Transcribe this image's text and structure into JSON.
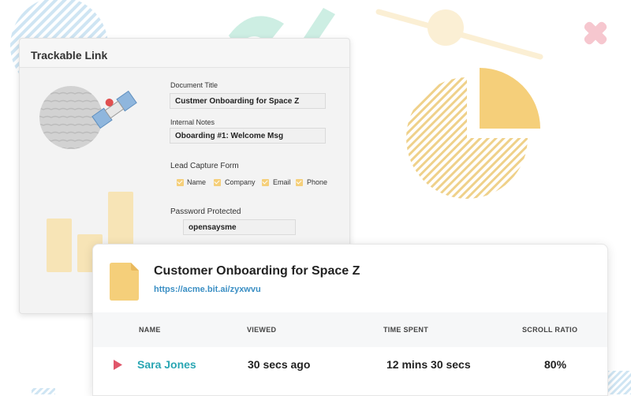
{
  "colors": {
    "accent_yellow": "#f5cf7a",
    "light_yellow": "#f7e4b6",
    "link_blue": "#3b8fc4",
    "name_teal": "#2aa6b3",
    "play_red": "#e0566a",
    "decor_mint": "#cdeee3",
    "decor_blue": "#cfe5f3",
    "decor_pink": "#f6c7cf"
  },
  "trackable_card": {
    "title": "Trackable Link",
    "document_title_label": "Document Title",
    "document_title_value": "Custmer Onboarding for Space Z",
    "internal_notes_label": "Internal Notes",
    "internal_notes_value": "Oboarding  #1: Welcome Msg",
    "lead_capture_label": "Lead Capture Form",
    "lead_fields": [
      {
        "label": "Name",
        "checked": true
      },
      {
        "label": "Company",
        "checked": true
      },
      {
        "label": "Email",
        "checked": true
      },
      {
        "label": "Phone",
        "checked": true
      }
    ],
    "password_label": "Password Protected",
    "password_value": "opensaysme"
  },
  "analytics_card": {
    "icon": "document-icon",
    "title": "Customer Onboarding for Space Z",
    "link": "https://acme.bit.ai/zyxwvu",
    "columns": [
      "NAME",
      "VIEWED",
      "TIME SPENT",
      "SCROLL RATIO"
    ],
    "rows": [
      {
        "name": "Sara Jones",
        "viewed": "30 secs ago",
        "time_spent": "12 mins 30 secs",
        "scroll_ratio": "80%"
      }
    ]
  },
  "pie_chart": {
    "highlighted_fraction": 0.25,
    "highlight_color": "#f5cf7a",
    "rest_color": "#f1d48a"
  }
}
